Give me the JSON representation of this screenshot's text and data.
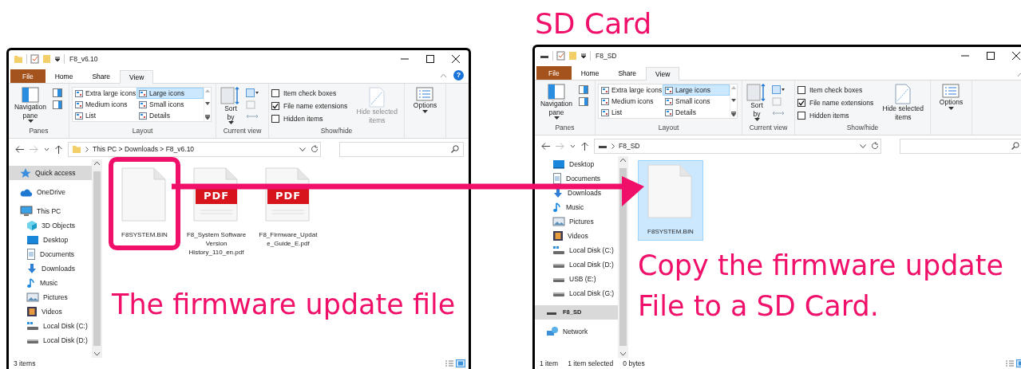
{
  "heading": "SD Card",
  "windows": [
    {
      "title": "F8_v6.10",
      "kind": "folder",
      "help": "?",
      "tabs": [
        {
          "label": "File",
          "kind": "backstage",
          "selected": false
        },
        {
          "label": "Home",
          "kind": "tab",
          "selected": false
        },
        {
          "label": "Share",
          "kind": "tab",
          "selected": false
        },
        {
          "label": "View",
          "kind": "tab",
          "selected": true
        }
      ],
      "ribbon": {
        "panes": {
          "label": "Panes",
          "navigation_pane": "Navigation pane"
        },
        "layout": {
          "label": "Layout",
          "options": [
            {
              "label": "Extra large icons",
              "selected": false
            },
            {
              "label": "Large icons",
              "selected": true
            },
            {
              "label": "Medium icons",
              "selected": false
            },
            {
              "label": "Small icons",
              "selected": false
            },
            {
              "label": "List",
              "selected": false
            },
            {
              "label": "Details",
              "selected": false
            }
          ]
        },
        "current_view": {
          "label": "Current view",
          "sort_by": "Sort by"
        },
        "show_hide": {
          "label": "Show/hide",
          "checkboxes": [
            {
              "label": "Item check boxes",
              "checked": false
            },
            {
              "label": "File name extensions",
              "checked": true
            },
            {
              "label": "Hidden items",
              "checked": false
            }
          ],
          "hide_selected": {
            "label": "Hide selected items",
            "disabled": true
          }
        },
        "options": "Options"
      },
      "address": "This PC > Downloads > F8_v6.10",
      "nav": [
        {
          "label": "Quick access",
          "kind": "star",
          "selected": true
        },
        {
          "label": "OneDrive",
          "kind": "cloud",
          "selected": false
        },
        {
          "label": "This PC",
          "kind": "pc",
          "selected": false,
          "children": [
            {
              "label": "3D Objects",
              "kind": "objects3d",
              "selected": false
            },
            {
              "label": "Desktop",
              "kind": "desktop",
              "selected": false
            },
            {
              "label": "Documents",
              "kind": "documents",
              "selected": false
            },
            {
              "label": "Downloads",
              "kind": "downloads",
              "selected": false
            },
            {
              "label": "Music",
              "kind": "music",
              "selected": false
            },
            {
              "label": "Pictures",
              "kind": "pictures",
              "selected": false
            },
            {
              "label": "Videos",
              "kind": "videos",
              "selected": false
            },
            {
              "label": "Local Disk (C:)",
              "kind": "system_drive",
              "selected": false
            },
            {
              "label": "Local Disk (D:)",
              "kind": "drive",
              "selected": false
            }
          ]
        }
      ],
      "files": [
        {
          "name": "F8SYSTEM.BIN",
          "kind": "file",
          "selected": false,
          "highlighted": true
        },
        {
          "name": "F8_System Software Version History_110_en.pdf",
          "kind": "pdf",
          "badge": "PDF",
          "selected": false,
          "highlighted": false
        },
        {
          "name": "F8_Firmware_Update_Guide_E.pdf",
          "kind": "pdf",
          "badge": "PDF",
          "selected": false,
          "highlighted": false
        }
      ],
      "status": [
        "3 items"
      ],
      "caption": [
        "The firmware update file"
      ]
    },
    {
      "title": "F8_SD",
      "kind": "drive",
      "tabs": [
        {
          "label": "File",
          "kind": "backstage",
          "selected": false
        },
        {
          "label": "Home",
          "kind": "tab",
          "selected": false
        },
        {
          "label": "Share",
          "kind": "tab",
          "selected": false
        },
        {
          "label": "View",
          "kind": "tab",
          "selected": true
        }
      ],
      "ribbon": {
        "panes": {
          "label": "Panes",
          "navigation_pane": "Navigation pane"
        },
        "layout": {
          "label": "Layout",
          "options": [
            {
              "label": "Extra large icons",
              "selected": false
            },
            {
              "label": "Large icons",
              "selected": true
            },
            {
              "label": "Medium icons",
              "selected": false
            },
            {
              "label": "Small icons",
              "selected": false
            },
            {
              "label": "List",
              "selected": false
            },
            {
              "label": "Details",
              "selected": false
            }
          ]
        },
        "current_view": {
          "label": "Current view",
          "sort_by": "Sort by"
        },
        "show_hide": {
          "label": "Show/hide",
          "checkboxes": [
            {
              "label": "Item check boxes",
              "checked": false
            },
            {
              "label": "File name extensions",
              "checked": true
            },
            {
              "label": "Hidden items",
              "checked": false
            }
          ],
          "hide_selected": {
            "label": "Hide selected items",
            "disabled": false
          }
        },
        "options": "Options"
      },
      "address": "F8_SD",
      "nav": [
        {
          "children": [
            {
              "label": "Desktop",
              "kind": "desktop",
              "selected": false
            },
            {
              "label": "Documents",
              "kind": "documents",
              "selected": false
            },
            {
              "label": "Downloads",
              "kind": "downloads",
              "selected": false
            },
            {
              "label": "Music",
              "kind": "music",
              "selected": false
            },
            {
              "label": "Pictures",
              "kind": "pictures",
              "selected": false
            },
            {
              "label": "Videos",
              "kind": "videos",
              "selected": false
            },
            {
              "label": "Local Disk (C:)",
              "kind": "system_drive",
              "selected": false
            },
            {
              "label": "Local Disk (D:)",
              "kind": "drive",
              "selected": false
            },
            {
              "label": "USB (E:)",
              "kind": "drive",
              "selected": false
            },
            {
              "label": "Local Disk (G:)",
              "kind": "drive",
              "selected": false
            }
          ]
        },
        {
          "label": "F8_SD",
          "kind": "sd_drive",
          "selected": true
        },
        {
          "label": "Network",
          "kind": "network",
          "selected": false
        }
      ],
      "files": [
        {
          "name": "F8SYSTEM.BIN",
          "kind": "file",
          "selected": true,
          "highlighted": false
        }
      ],
      "status": [
        "1 item",
        "1 item selected",
        "0 bytes"
      ],
      "caption": [
        "Copy the firmware update",
        "File to a SD Card."
      ]
    }
  ]
}
